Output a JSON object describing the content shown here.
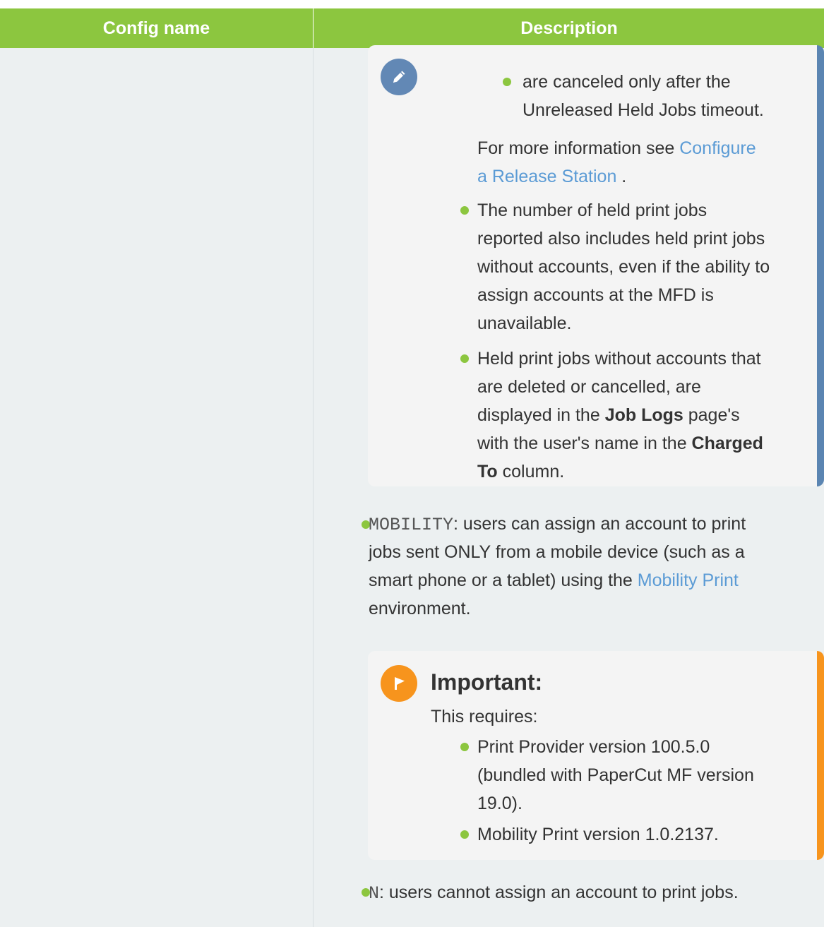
{
  "table": {
    "header": {
      "col1": "Config name",
      "col2": "Description"
    }
  },
  "note": {
    "icon": "pencil-icon",
    "bullet0": {
      "lines": [
        "are canceled only after the",
        "Unreleased Held Jobs timeout."
      ]
    },
    "more_info": {
      "prefix": "For more information see ",
      "link_line1": "Configure",
      "link_line2": "a Release Station",
      "suffix": " ."
    },
    "bullet1": {
      "lines": [
        "The number of held print jobs",
        "reported also includes held print jobs",
        "without accounts, even if the ability to",
        "assign accounts at the MFD is",
        "unavailable."
      ]
    },
    "bullet2": {
      "line1": "Held print jobs without accounts that",
      "line2": "are deleted or cancelled, are",
      "line3_prefix": "displayed in the ",
      "line3_bold": "Job Logs",
      "line3_suffix": " page's",
      "line4_prefix": "with the user's name in the ",
      "line4_bold": "Charged",
      "line5_bold": "To",
      "line5_suffix": " column."
    }
  },
  "mobility": {
    "code": "MOBILITY",
    "line1_text": ": users can assign an account to print",
    "line2": "jobs sent ONLY from a mobile device (such as a",
    "line3_prefix": "smart phone or a tablet) using the ",
    "line3_link": "Mobility Print",
    "line4": "environment."
  },
  "important": {
    "icon": "flag-icon",
    "title": "Important:",
    "intro": "This requires:",
    "item1": {
      "lines": [
        "Print Provider version 100.5.0",
        "(bundled with PaperCut MF version",
        "19.0)."
      ]
    },
    "item2": "Mobility Print version 1.0.2137."
  },
  "n_option": {
    "code": "N",
    "text": ": users cannot assign an account to print jobs."
  },
  "colors": {
    "header_green": "#8cc63f",
    "bullet_green": "#8cc63f",
    "note_blue": "#5b85b2",
    "important_orange": "#f7941d",
    "link_blue": "#5b9bd5"
  }
}
